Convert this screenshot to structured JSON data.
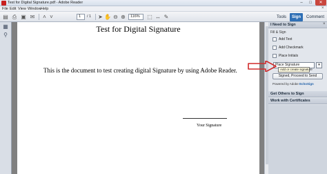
{
  "window": {
    "title": "Test for Digital Signature.pdf - Adobe Reader"
  },
  "menu": {
    "items": [
      "File",
      "Edit",
      "View",
      "Window",
      "Help"
    ]
  },
  "toolbar": {
    "page_current": "1",
    "page_total": "/ 1",
    "zoom": "116%",
    "tabs": [
      "Tools",
      "Sign",
      "Comment"
    ]
  },
  "document": {
    "title": "Test for Digital Signature",
    "body": "This is the document to test creating digital Signature by using Adobe Reader.",
    "signature_label": "Your Signature"
  },
  "panel": {
    "section_need_to_sign": "I Need to Sign",
    "fill_sign_label": "Fill & Sign",
    "tools": [
      "Add Text",
      "Add Checkmark",
      "Place Initials"
    ],
    "place_signature": "Place Signature",
    "tooltip": "Add or create signature",
    "send_button": "Signed, Proceed to Send",
    "powered_by": "Powered by Adobe",
    "powered_brand": "EchoSign",
    "section_get_others": "Get Others to Sign",
    "section_certificates": "Work with Certificates"
  },
  "colors": {
    "accent_red": "#d02a2a",
    "tab_active": "#2f6fb5"
  }
}
